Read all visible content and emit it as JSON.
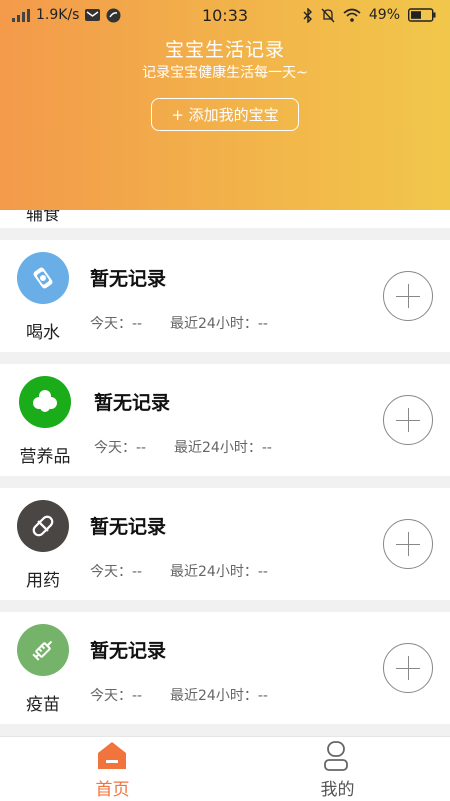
{
  "status_bar": {
    "speed": "1.9K/s",
    "time": "10:33",
    "battery": "49%"
  },
  "header": {
    "title": "宝宝生活记录",
    "subtitle": "记录宝宝健康生活每一天~",
    "add_button": "+ 添加我的宝宝"
  },
  "partial_item": {
    "label": "辅食"
  },
  "records": [
    {
      "label": "喝水",
      "status": "暂无记录",
      "today": "今天：--",
      "last24": "最近24小时：--",
      "icon": "water-bottle-icon",
      "color": "#69aee6"
    },
    {
      "label": "营养品",
      "status": "暂无记录",
      "today": "今天：--",
      "last24": "最近24小时：--",
      "icon": "clover-icon",
      "color": "#1aad19"
    },
    {
      "label": "用药",
      "status": "暂无记录",
      "today": "今天：--",
      "last24": "最近24小时：--",
      "icon": "pill-icon",
      "color": "#4a4644"
    },
    {
      "label": "疫苗",
      "status": "暂无记录",
      "today": "今天：--",
      "last24": "最近24小时：--",
      "icon": "syringe-icon",
      "color": "#76b36a"
    }
  ],
  "tabs": [
    {
      "label": "首页",
      "icon": "home-icon",
      "color": "#f0743c"
    },
    {
      "label": "我的",
      "icon": "profile-icon",
      "color": "#666666"
    }
  ]
}
